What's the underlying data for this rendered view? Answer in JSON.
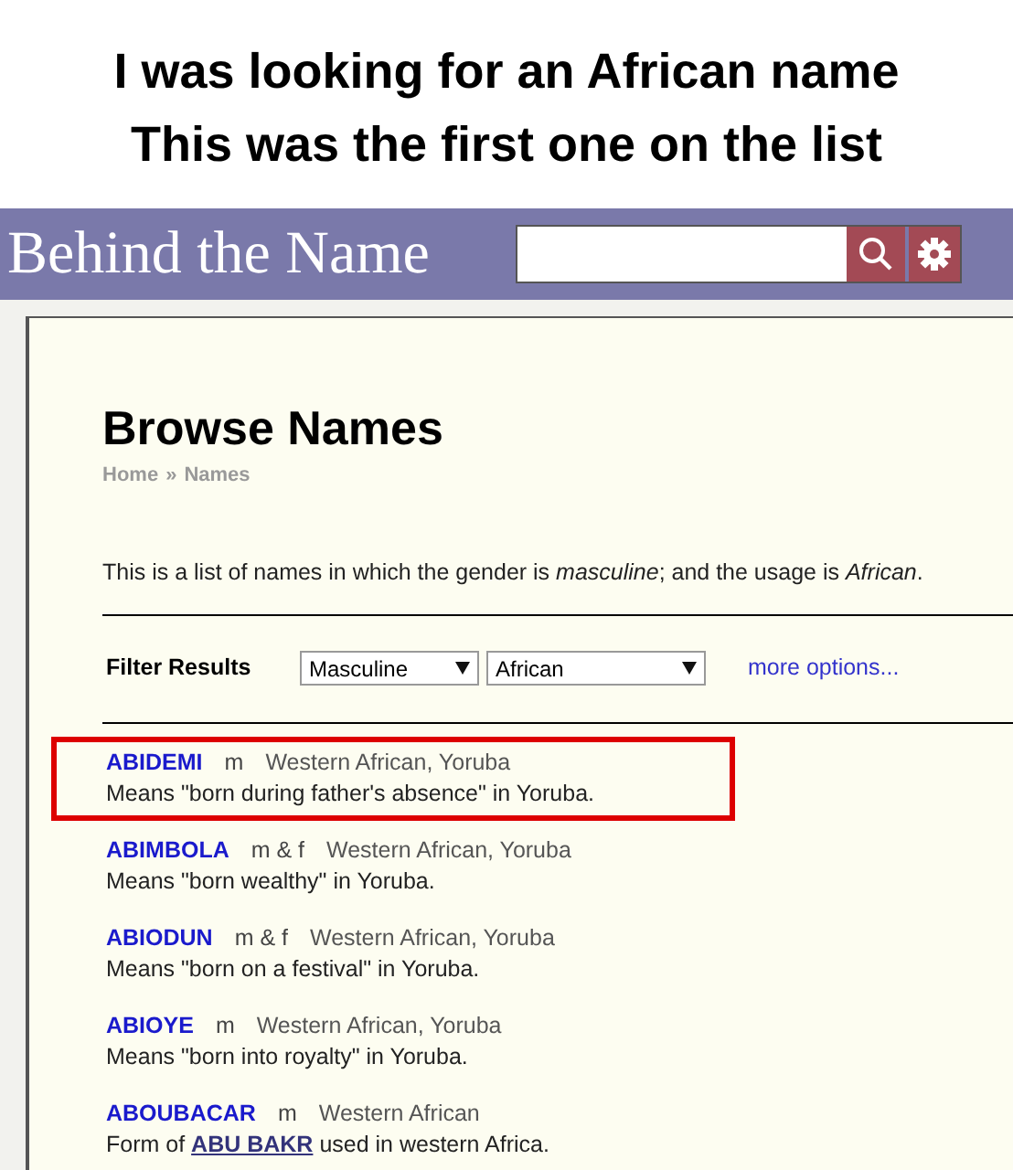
{
  "caption": [
    "I was looking for an African name",
    "This was the first one on the list"
  ],
  "header": {
    "logo": "Behind the Name"
  },
  "page": {
    "title": "Browse Names",
    "breadcrumb": [
      {
        "label": "Home"
      },
      {
        "label": "»"
      },
      {
        "label": "Names"
      }
    ],
    "intro": "This is a list of names in which the gender is *masculine*; and the usage is *African*.",
    "filter": {
      "label": "Filter Results",
      "gender": "Masculine",
      "usage": "African",
      "more": "more options..."
    },
    "names": [
      {
        "name": "ABIDEMI",
        "gender": "m",
        "usage": "Western African, Yoruba",
        "highlighted": true,
        "description": [
          {
            "kind": "text",
            "text": "Means \"born during father's absence\" in Yoruba."
          }
        ]
      },
      {
        "name": "ABIMBOLA",
        "gender": "m & f",
        "usage": "Western African, Yoruba",
        "highlighted": false,
        "description": [
          {
            "kind": "text",
            "text": "Means \"born wealthy\" in Yoruba."
          }
        ]
      },
      {
        "name": "ABIODUN",
        "gender": "m & f",
        "usage": "Western African, Yoruba",
        "highlighted": false,
        "description": [
          {
            "kind": "text",
            "text": "Means \"born on a festival\" in Yoruba."
          }
        ]
      },
      {
        "name": "ABIOYE",
        "gender": "m",
        "usage": "Western African, Yoruba",
        "highlighted": false,
        "description": [
          {
            "kind": "text",
            "text": "Means \"born into royalty\" in Yoruba."
          }
        ]
      },
      {
        "name": "ABOUBACAR",
        "gender": "m",
        "usage": "Western African",
        "highlighted": false,
        "description": [
          {
            "kind": "text",
            "text": "Form of "
          },
          {
            "kind": "link",
            "text": "ABU BAKR"
          },
          {
            "kind": "text",
            "text": " used in western Africa."
          }
        ]
      }
    ]
  }
}
